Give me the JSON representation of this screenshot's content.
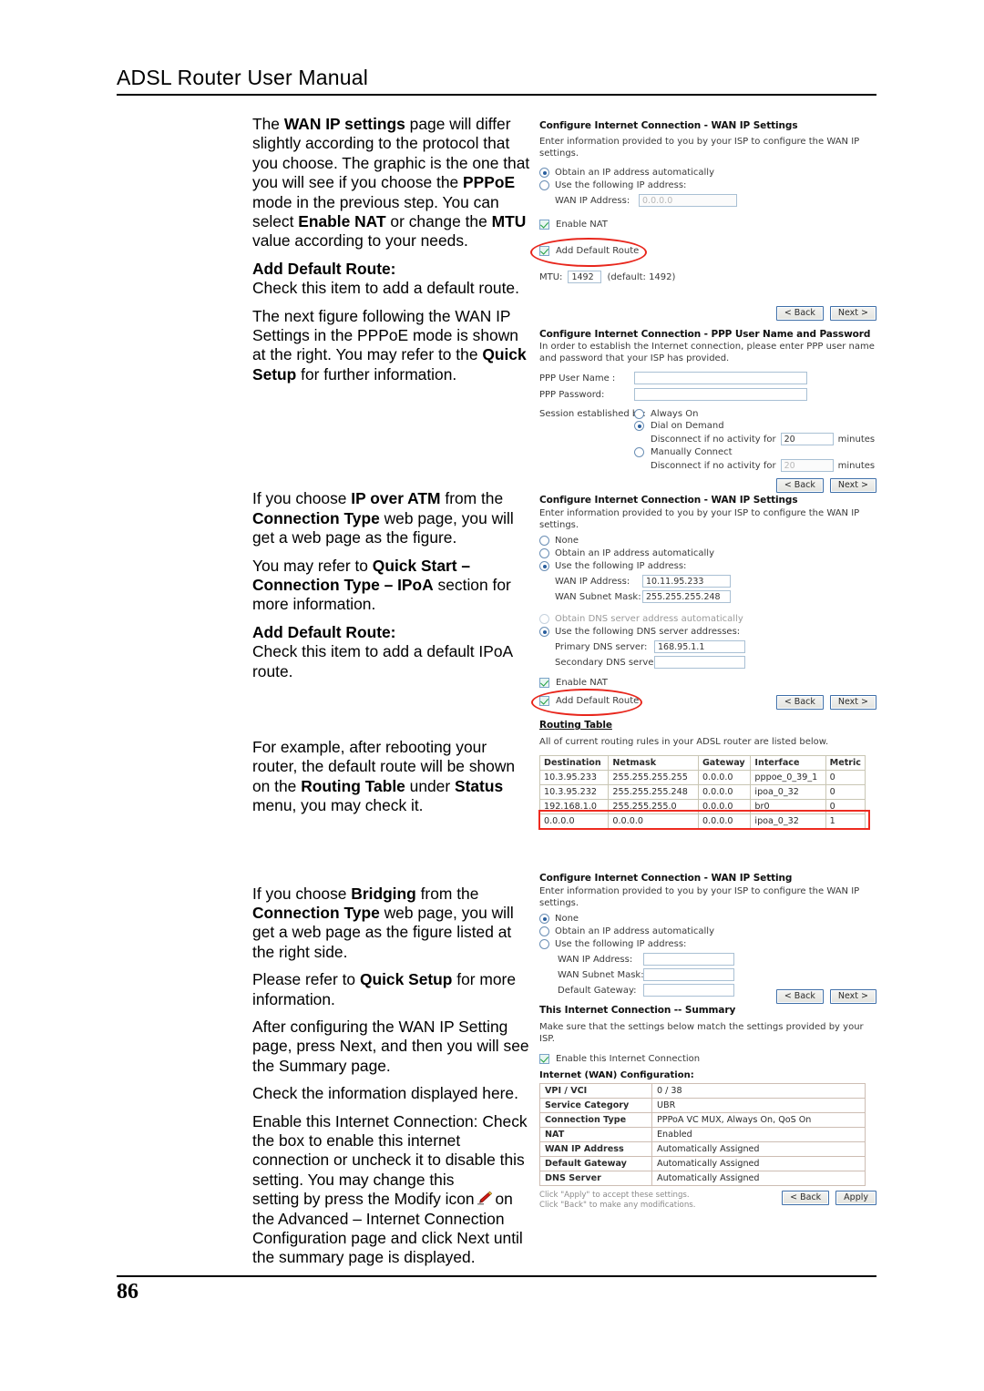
{
  "header": {
    "title": "ADSL Router User Manual"
  },
  "footer": {
    "page_number": "86"
  },
  "prose": {
    "p1_a": "The ",
    "p1_b": "WAN IP settings",
    "p1_c": " page will differ slightly according to the protocol that you choose. The graphic is the one that you will see if you choose the ",
    "p1_d": "PPPoE",
    "p1_e": " mode in the previous step. You can select ",
    "p1_f": "Enable NAT",
    "p1_g": " or change the ",
    "p1_h": "MTU",
    "p1_i": " value according to your needs.",
    "h1": "Add Default Route:",
    "p2": "Check this item to add a default route.",
    "p3_a": "The next figure following the WAN IP Settings in the PPPoE mode is shown at the right. You may refer to the ",
    "p3_b": "Quick Setup",
    "p3_c": " for further information.",
    "p4_a": "If you choose ",
    "p4_b": "IP over ATM",
    "p4_c": " from the ",
    "p4_d": "Connection Type",
    "p4_e": " web page, you will get a web page as the figure.",
    "p5_a": "You may refer to ",
    "p5_b": "Quick Start –",
    "p5_c": " ",
    "p5_d": "Connection Type – IPoA",
    "p5_e": " section for more information.",
    "h2": "Add Default Route:",
    "p6": "Check this item to add a default IPoA route.",
    "p7_a": "For example, after rebooting your router, the default route will be shown on the ",
    "p7_b": "Routing Table",
    "p7_c": " under ",
    "p7_d": "Status",
    "p7_e": " menu, you may check it.",
    "p8_a": "If you choose ",
    "p8_b": "Bridging",
    "p8_c": " from the ",
    "p8_d": "Connection Type",
    "p8_e": " web page, you will get a web page as the figure listed at the right side.",
    "p9_a": "Please refer to ",
    "p9_b": "Quick Setup",
    "p9_c": " for more information.",
    "p10": "After configuring the WAN IP Setting page, press Next, and then you will see the Summary page.",
    "p11": "Check the information displayed here.",
    "p12_a": "Enable this Internet Connection: Check the box to enable this internet connection or uncheck it to disable this setting. You may change this",
    "p12_b": "setting by press the Modify icon",
    "p12_c": "on the Advanced – Internet Connection Configuration page and click Next until the summary page is displayed."
  },
  "fig_wanip_pppoe": {
    "title": "Configure Internet Connection - WAN IP Settings",
    "desc": "Enter information provided to you by your ISP to configure the WAN IP settings.",
    "radio_auto": "Obtain an IP address automatically",
    "radio_static": "Use the following IP address:",
    "wan_ip_label": "WAN IP Address:",
    "wan_ip_value": "0.0.0.0",
    "enable_nat": "Enable NAT",
    "add_default_route": "Add Default Route",
    "mtu_label": "MTU:",
    "mtu_value": "1492",
    "mtu_default": "(default: 1492)",
    "back": "< Back",
    "next": "Next >"
  },
  "fig_ppp": {
    "title_a": "Configure Internet Connection",
    "title_b": " - PPP User Name and Password",
    "desc": "In order to establish the Internet connection, please enter PPP user name and password that your ISP has provided.",
    "user_label": "PPP User Name :",
    "user_value": "",
    "pass_label": "PPP Password:",
    "pass_value": "",
    "session_label": "Session established by:",
    "opt_always": "Always On",
    "opt_dial": "Dial on Demand",
    "disconnect_1": "Disconnect if no activity for",
    "minutes_1": "minutes",
    "timeout_1": "20",
    "opt_manual": "Manually Connect",
    "disconnect_2": "Disconnect if no activity for",
    "minutes_2": "minutes",
    "timeout_2": "20",
    "back": "< Back",
    "next": "Next >"
  },
  "fig_wanip_ipoa": {
    "title": "Configure Internet Connection - WAN IP Settings",
    "desc": "Enter information provided to you by your ISP to configure the WAN IP settings.",
    "radio_none": "None",
    "radio_auto": "Obtain an IP address automatically",
    "radio_static": "Use the following IP address:",
    "wan_ip_label": "WAN IP Address:",
    "wan_ip_value": "10.11.95.233",
    "wan_mask_label": "WAN Subnet Mask:",
    "wan_mask_value": "255.255.255.248",
    "dns_auto": "Obtain DNS server address automatically",
    "dns_static": "Use the following DNS server addresses:",
    "dns1_label": "Primary DNS server:",
    "dns1_value": "168.95.1.1",
    "dns2_label": "Secondary DNS server:",
    "dns2_value": "",
    "enable_nat": "Enable NAT",
    "add_default_route": "Add Default Route",
    "back": "< Back",
    "next": "Next >"
  },
  "fig_routing": {
    "title": "Routing Table",
    "desc": "All of current routing rules in your ADSL router are listed below.",
    "columns": [
      "Destination",
      "Netmask",
      "Gateway",
      "Interface",
      "Metric"
    ],
    "rows": [
      [
        "10.3.95.233",
        "255.255.255.255",
        "0.0.0.0",
        "pppoe_0_39_1",
        "0"
      ],
      [
        "10.3.95.232",
        "255.255.255.248",
        "0.0.0.0",
        "ipoa_0_32",
        "0"
      ],
      [
        "192.168.1.0",
        "255.255.255.0",
        "0.0.0.0",
        "br0",
        "0"
      ],
      [
        "0.0.0.0",
        "0.0.0.0",
        "0.0.0.0",
        "ipoa_0_32",
        "1"
      ]
    ],
    "highlighted_row_index": 3
  },
  "fig_bridging": {
    "title": "Configure Internet Connection - WAN IP Setting",
    "desc": "Enter information provided to you by your ISP to configure the WAN IP settings.",
    "radio_none": "None",
    "radio_auto": "Obtain an IP address automatically",
    "radio_static": "Use the following IP address:",
    "wan_ip_label": "WAN IP Address:",
    "wan_ip_value": "",
    "wan_mask_label": "WAN Subnet Mask:",
    "wan_mask_value": "",
    "gateway_label": "Default Gateway:",
    "gateway_value": "",
    "back": "< Back",
    "next": "Next >"
  },
  "fig_summary": {
    "title": "This Internet Connection -- Summary",
    "desc": "Make sure that the settings below match the settings provided by your ISP.",
    "enable_conn": "Enable this Internet Connection",
    "table_caption": "Internet (WAN) Configuration:",
    "rows": [
      [
        "VPI / VCI",
        "0 / 38"
      ],
      [
        "Service Category",
        "UBR"
      ],
      [
        "Connection Type",
        "PPPoA VC MUX, Always On, QoS On"
      ],
      [
        "NAT",
        "Enabled"
      ],
      [
        "WAN IP Address",
        "Automatically Assigned"
      ],
      [
        "Default Gateway",
        "Automatically Assigned"
      ],
      [
        "DNS Server",
        "Automatically Assigned"
      ]
    ],
    "note_1": "Click \"Apply\" to accept these settings.",
    "note_2": "Click \"Back\" to make any modifications.",
    "back": "< Back",
    "apply": "Apply"
  },
  "colors": {
    "annotation_red": "#e8261c",
    "checkbox_check": "#1e9e3e",
    "radio_dot": "#2a5f9e",
    "button_border": "#3f6fa8"
  }
}
